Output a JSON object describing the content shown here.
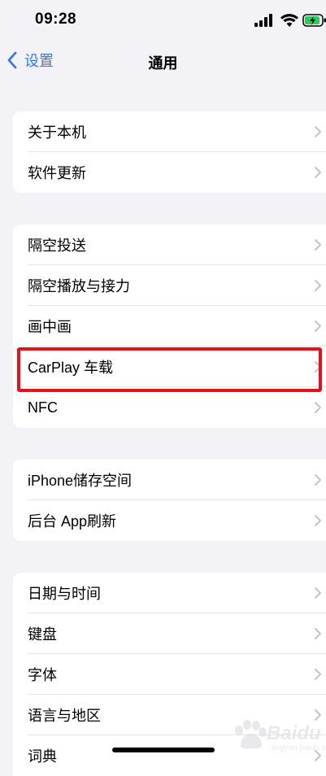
{
  "status_bar": {
    "time": "09:28"
  },
  "nav": {
    "back_label": "设置",
    "title": "通用"
  },
  "groups": [
    {
      "items": [
        "关于本机",
        "软件更新"
      ]
    },
    {
      "items": [
        "隔空投送",
        "隔空播放与接力",
        "画中画",
        "CarPlay 车载",
        "NFC"
      ]
    },
    {
      "items": [
        "iPhone储存空间",
        "后台 App刷新"
      ]
    },
    {
      "items": [
        "日期与时间",
        "键盘",
        "字体",
        "语言与地区",
        "词典"
      ]
    }
  ],
  "highlighted_item": "CarPlay 车载",
  "watermark": {
    "text": "Baidu",
    "sub": "jingyan.baidu.com"
  },
  "colors": {
    "accent": "#3478f6",
    "background": "#f2f2f7",
    "highlight": "#e3121b",
    "battery": "#34c759"
  }
}
